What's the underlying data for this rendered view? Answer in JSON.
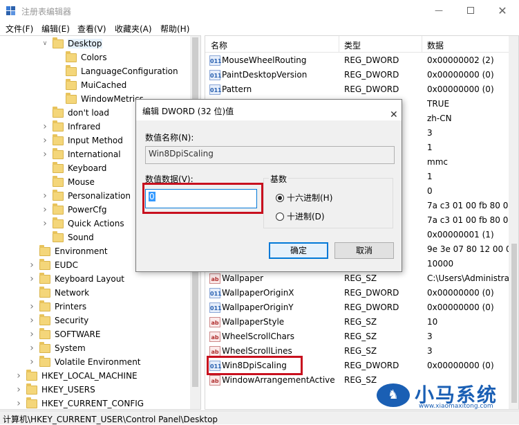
{
  "window": {
    "title": "注册表编辑器"
  },
  "menu": [
    "文件(F)",
    "编辑(E)",
    "查看(V)",
    "收藏夹(A)",
    "帮助(H)"
  ],
  "tree": [
    {
      "label": "Desktop",
      "level": 3,
      "arrow": "expanded",
      "selected": true
    },
    {
      "label": "Colors",
      "level": 4,
      "arrow": "none"
    },
    {
      "label": "LanguageConfiguration",
      "level": 4,
      "arrow": "none"
    },
    {
      "label": "MuiCached",
      "level": 4,
      "arrow": "none"
    },
    {
      "label": "WindowMetrics",
      "level": 4,
      "arrow": "none"
    },
    {
      "label": "don't load",
      "level": 3,
      "arrow": "none"
    },
    {
      "label": "Infrared",
      "level": 3,
      "arrow": "collapsed"
    },
    {
      "label": "Input Method",
      "level": 3,
      "arrow": "collapsed"
    },
    {
      "label": "International",
      "level": 3,
      "arrow": "collapsed"
    },
    {
      "label": "Keyboard",
      "level": 3,
      "arrow": "none"
    },
    {
      "label": "Mouse",
      "level": 3,
      "arrow": "none"
    },
    {
      "label": "Personalization",
      "level": 3,
      "arrow": "collapsed"
    },
    {
      "label": "PowerCfg",
      "level": 3,
      "arrow": "collapsed"
    },
    {
      "label": "Quick Actions",
      "level": 3,
      "arrow": "collapsed"
    },
    {
      "label": "Sound",
      "level": 3,
      "arrow": "none"
    },
    {
      "label": "Environment",
      "level": 2,
      "arrow": "none"
    },
    {
      "label": "EUDC",
      "level": 2,
      "arrow": "collapsed"
    },
    {
      "label": "Keyboard Layout",
      "level": 2,
      "arrow": "collapsed"
    },
    {
      "label": "Network",
      "level": 2,
      "arrow": "none"
    },
    {
      "label": "Printers",
      "level": 2,
      "arrow": "collapsed"
    },
    {
      "label": "Security",
      "level": 2,
      "arrow": "collapsed"
    },
    {
      "label": "SOFTWARE",
      "level": 2,
      "arrow": "collapsed"
    },
    {
      "label": "System",
      "level": 2,
      "arrow": "collapsed"
    },
    {
      "label": "Volatile Environment",
      "level": 2,
      "arrow": "collapsed"
    },
    {
      "label": "HKEY_LOCAL_MACHINE",
      "level": 1,
      "arrow": "collapsed"
    },
    {
      "label": "HKEY_USERS",
      "level": 1,
      "arrow": "collapsed"
    },
    {
      "label": "HKEY_CURRENT_CONFIG",
      "level": 1,
      "arrow": "collapsed"
    }
  ],
  "columns": {
    "name": "名称",
    "type": "类型",
    "data": "数据"
  },
  "values": [
    {
      "name": "MouseWheelRouting",
      "type": "REG_DWORD",
      "data": "0x00000002 (2)",
      "icon": "dword"
    },
    {
      "name": "PaintDesktopVersion",
      "type": "REG_DWORD",
      "data": "0x00000000 (0)",
      "icon": "dword"
    },
    {
      "name": "Pattern",
      "type": "REG_DWORD",
      "data": "0x00000000 (0)",
      "icon": "dword"
    },
    {
      "name": "",
      "type": "",
      "data": "TRUE",
      "icon": ""
    },
    {
      "name": "",
      "type": "",
      "data": "zh-CN",
      "icon": ""
    },
    {
      "name": "",
      "type": "",
      "data": "3",
      "icon": ""
    },
    {
      "name": "",
      "type": "",
      "data": "1",
      "icon": ""
    },
    {
      "name": "",
      "type": "",
      "data": "mmc",
      "icon": ""
    },
    {
      "name": "",
      "type": "",
      "data": "1",
      "icon": ""
    },
    {
      "name": "",
      "type": "",
      "data": "0",
      "icon": ""
    },
    {
      "name": "",
      "type": "",
      "data": "7a c3 01 00 fb 80 04",
      "icon": ""
    },
    {
      "name": "",
      "type": "",
      "data": "7a c3 01 00 fb 80 04",
      "icon": ""
    },
    {
      "name": "",
      "type": "",
      "data": "0x00000001 (1)",
      "icon": ""
    },
    {
      "name": "",
      "type": "",
      "data": "9e 3e 07 80 12 00 0",
      "icon": ""
    },
    {
      "name": "",
      "type": "",
      "data": "10000",
      "icon": ""
    },
    {
      "name": "Wallpaper",
      "type": "REG_SZ",
      "data": "C:\\Users\\Administra",
      "icon": "sz"
    },
    {
      "name": "WallpaperOriginX",
      "type": "REG_DWORD",
      "data": "0x00000000 (0)",
      "icon": "dword"
    },
    {
      "name": "WallpaperOriginY",
      "type": "REG_DWORD",
      "data": "0x00000000 (0)",
      "icon": "dword"
    },
    {
      "name": "WallpaperStyle",
      "type": "REG_SZ",
      "data": "10",
      "icon": "sz"
    },
    {
      "name": "WheelScrollChars",
      "type": "REG_SZ",
      "data": "3",
      "icon": "sz"
    },
    {
      "name": "WheelScrollLines",
      "type": "REG_SZ",
      "data": "3",
      "icon": "sz"
    },
    {
      "name": "Win8DpiScaling",
      "type": "REG_DWORD",
      "data": "0x00000000 (0)",
      "icon": "dword"
    },
    {
      "name": "WindowArrangementActive",
      "type": "REG_SZ",
      "data": "",
      "icon": "sz"
    }
  ],
  "icon_text": {
    "sz": "ab",
    "dword": "011"
  },
  "dialog": {
    "title": "编辑 DWORD (32 位)值",
    "name_label": "数值名称(N):",
    "name_value": "Win8DpiScaling",
    "data_label": "数值数据(V):",
    "data_value": "0",
    "base_label": "基数",
    "hex_label": "十六进制(H)",
    "dec_label": "十进制(D)",
    "ok": "确定",
    "cancel": "取消"
  },
  "status": "计算机\\HKEY_CURRENT_USER\\Control Panel\\Desktop",
  "watermark": {
    "brand": "小马系统",
    "url": "www.xiaomaxitong.com"
  },
  "colors": {
    "highlight": "#c8101e",
    "accent": "#0078d7",
    "brand": "#1a5fb4"
  }
}
